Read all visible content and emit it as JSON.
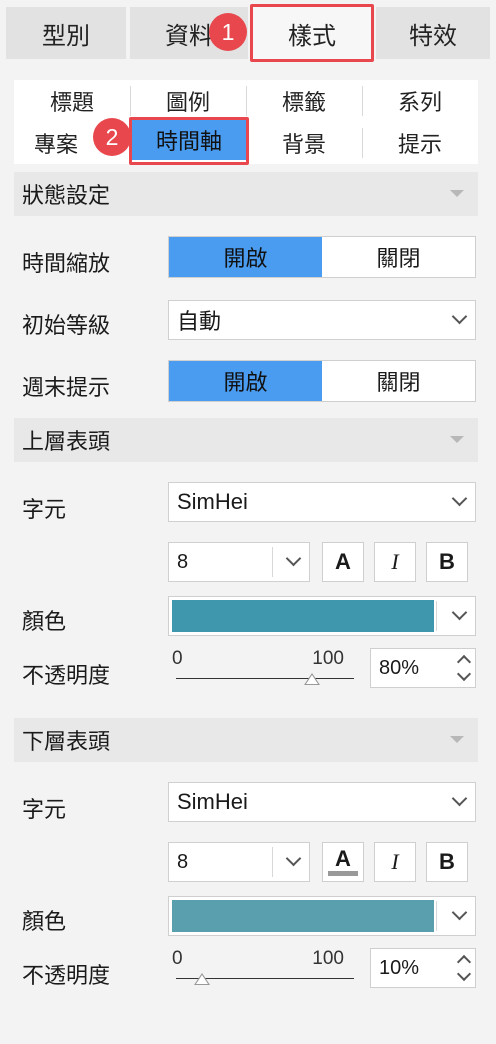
{
  "top_tabs": [
    "型別",
    "資料",
    "樣式",
    "特效"
  ],
  "badges": [
    "1",
    "2"
  ],
  "sub_tabs": {
    "row1": [
      "標題",
      "圖例",
      "標籤",
      "系列"
    ],
    "row2": [
      "專案",
      "時間軸",
      "背景",
      "提示"
    ]
  },
  "state": {
    "header": "狀態設定",
    "time_zoom_label": "時間縮放",
    "time_zoom_on": "開啟",
    "time_zoom_off": "關閉",
    "init_level_label": "初始等級",
    "init_level_value": "自動",
    "weekend_label": "週末提示",
    "weekend_on": "開啟",
    "weekend_off": "關閉"
  },
  "upper": {
    "header": "上層表頭",
    "font_label": "字元",
    "font_value": "SimHei",
    "size_value": "8",
    "bold_btn": "A",
    "italic_btn": "I",
    "b_btn": "B",
    "color_label": "顏色",
    "color": "#3f97ad",
    "opacity_label": "不透明度",
    "slider_min": "0",
    "slider_max": "100",
    "opacity_value": "80%",
    "opacity": 0.8
  },
  "lower": {
    "header": "下層表頭",
    "font_label": "字元",
    "font_value": "SimHei",
    "size_value": "8",
    "bold_btn": "A",
    "italic_btn": "I",
    "b_btn": "B",
    "color_label": "顏色",
    "color": "#5a9fad",
    "opacity_label": "不透明度",
    "slider_min": "0",
    "slider_max": "100",
    "opacity_value": "10%",
    "opacity": 0.1
  },
  "colors": {
    "accent": "#4a9cf0",
    "highlight": "#e8484d"
  }
}
